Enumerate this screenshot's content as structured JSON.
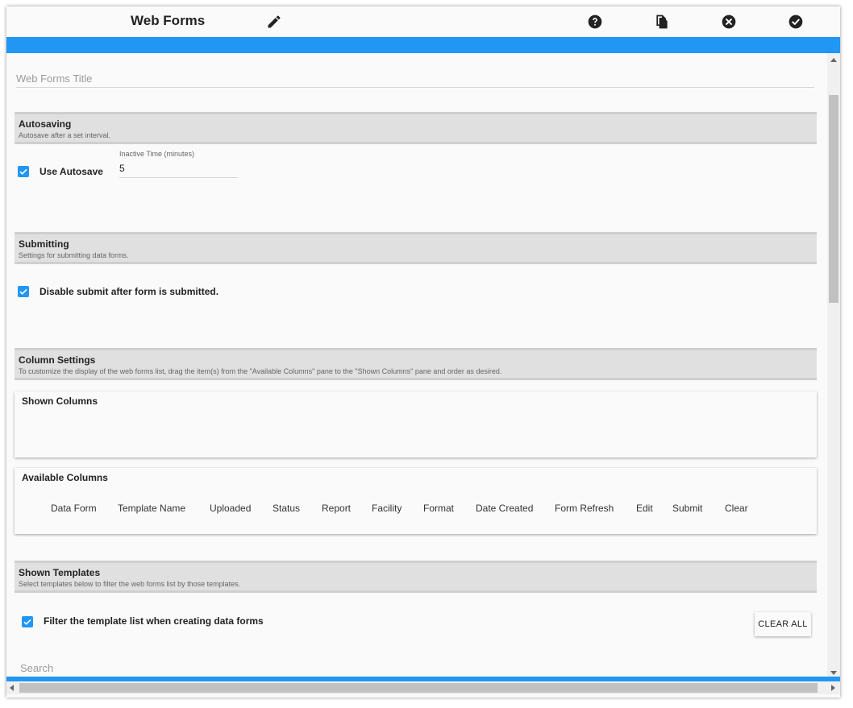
{
  "header": {
    "title": "Web Forms",
    "icons": [
      "pencil-icon",
      "help-icon",
      "copy-icon",
      "close-icon",
      "check-icon"
    ]
  },
  "colors": {
    "accent": "#2196f3",
    "section_bg": "#e0e0e0"
  },
  "title_field": {
    "placeholder": "Web Forms Title"
  },
  "autosaving": {
    "title": "Autosaving",
    "subtitle": "Autosave after a set interval.",
    "checkbox_label": "Use Autosave",
    "checked": true,
    "inactive_label": "Inactive Time (minutes)",
    "inactive_value": "5"
  },
  "submitting": {
    "title": "Submitting",
    "subtitle": "Settings for submitting data forms.",
    "checkbox_label": "Disable submit after form is submitted.",
    "checked": true
  },
  "column_settings": {
    "title": "Column Settings",
    "subtitle": "To customize the display of the web forms list, drag the item(s) from the \"Available Columns\" pane to the \"Shown Columns\" pane and order as desired.",
    "shown_title": "Shown Columns",
    "available_title": "Available Columns",
    "available_columns": [
      "Data Form",
      "Template Name",
      "Uploaded",
      "Status",
      "Report",
      "Facility",
      "Format",
      "Date Created",
      "Form Refresh",
      "Edit",
      "Submit",
      "Clear"
    ]
  },
  "shown_templates": {
    "title": "Shown Templates",
    "subtitle": "Select templates below to filter the web forms list by those templates.",
    "checkbox_label": "Filter the template list when creating data forms",
    "checked": true,
    "clear_all_label": "CLEAR ALL",
    "search_placeholder": "Search"
  }
}
